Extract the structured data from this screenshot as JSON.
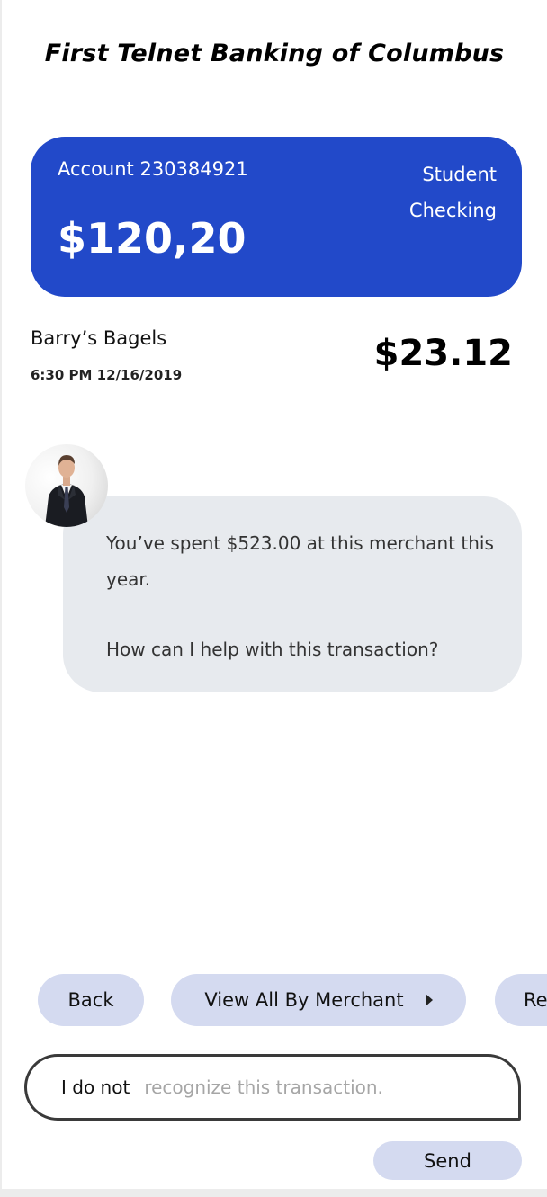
{
  "header": {
    "bank_name": "First Telnet Banking of Columbus"
  },
  "account": {
    "number_label": "Account 230384921",
    "type_line1": "Student",
    "type_line2": "Checking",
    "balance": "$120,20",
    "card_color": "#2249c9"
  },
  "transaction": {
    "merchant": "Barry’s Bagels",
    "datetime": "6:30 PM 12/16/2019",
    "amount": "$23.12"
  },
  "assistant": {
    "avatar_icon": "person-avatar-icon",
    "message_line1": "You’ve spent $523.00 at this merchant this year.",
    "message_line2": "How can I help with this transaction?"
  },
  "actions": {
    "back_label": "Back",
    "view_all_label": "View All By Merchant",
    "view_all_icon": "play-arrow-icon",
    "more_label": "Re"
  },
  "composer": {
    "typed_text": "I do not",
    "suggestion_text": "recognize this transaction.",
    "send_label": "Send"
  },
  "colors": {
    "accent": "#2249c9",
    "chip": "#d4daf0",
    "bubble": "#e7eaee"
  }
}
